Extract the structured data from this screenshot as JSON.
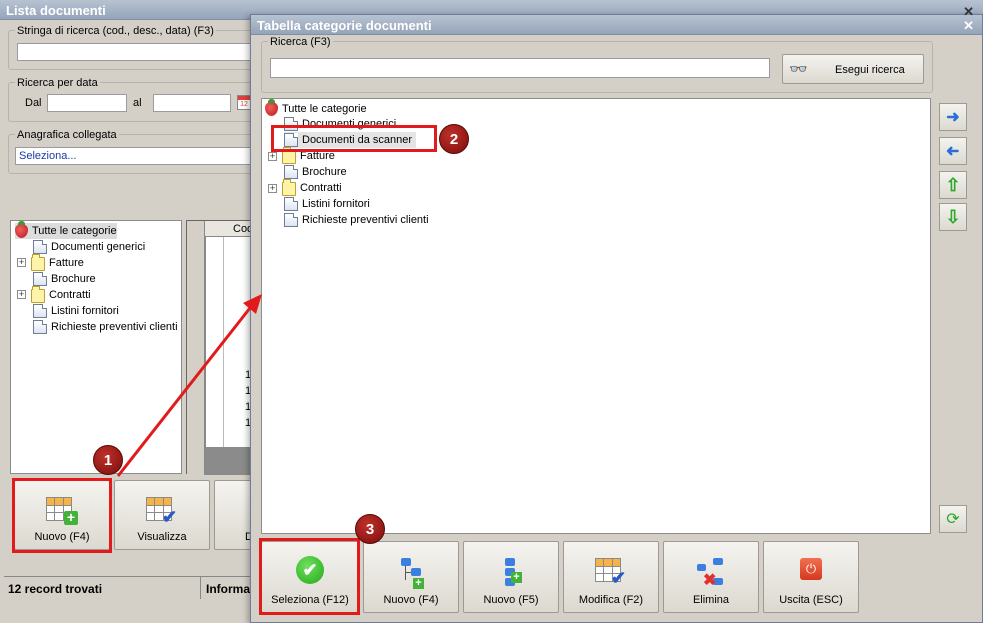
{
  "back_window": {
    "title": "Lista documenti",
    "search_group_label": "Stringa di ricerca (cod., desc., data) (F3)",
    "date_group_label": "Ricerca per data",
    "date_from_label": "Dal",
    "date_to_label": "al",
    "linked_group_label": "Anagrafica collegata",
    "linked_select_value": "Seleziona...",
    "tree": {
      "root": "Tutte le categorie",
      "items": [
        "Documenti generici",
        "Fatture",
        "Brochure",
        "Contratti",
        "Listini fornitori",
        "Richieste preventivi clienti"
      ]
    },
    "grid": {
      "header": "Cod",
      "row_values": [
        "1",
        "1",
        "1",
        "1"
      ]
    },
    "buttons": {
      "new_label": "Nuovo (F4)",
      "view_label": "Visualizza",
      "third_label": "D"
    },
    "status": {
      "records": "12 record trovati",
      "info": "Informa"
    }
  },
  "dialog": {
    "title": "Tabella categorie documenti",
    "search_group_label": "Ricerca (F3)",
    "search_value": "",
    "search_button_label": "Esegui ricerca",
    "tree": {
      "root": "Tutte le categorie",
      "items": [
        "Documenti generici",
        "Documenti da scanner",
        "Fatture",
        "Brochure",
        "Contratti",
        "Listini fornitori",
        "Richieste preventivi clienti"
      ]
    },
    "buttons": {
      "select_label": "Seleziona (F12)",
      "new_f4_label": "Nuovo (F4)",
      "new_f5_label": "Nuovo (F5)",
      "edit_label": "Modifica (F2)",
      "delete_label": "Elimina",
      "exit_label": "Uscita (ESC)"
    }
  },
  "callouts": [
    "1",
    "2",
    "3"
  ],
  "colors": {
    "highlight_red": "#e11b1b",
    "callout_fill": "#9b1a16",
    "titlebar": "#a9b6c8"
  }
}
